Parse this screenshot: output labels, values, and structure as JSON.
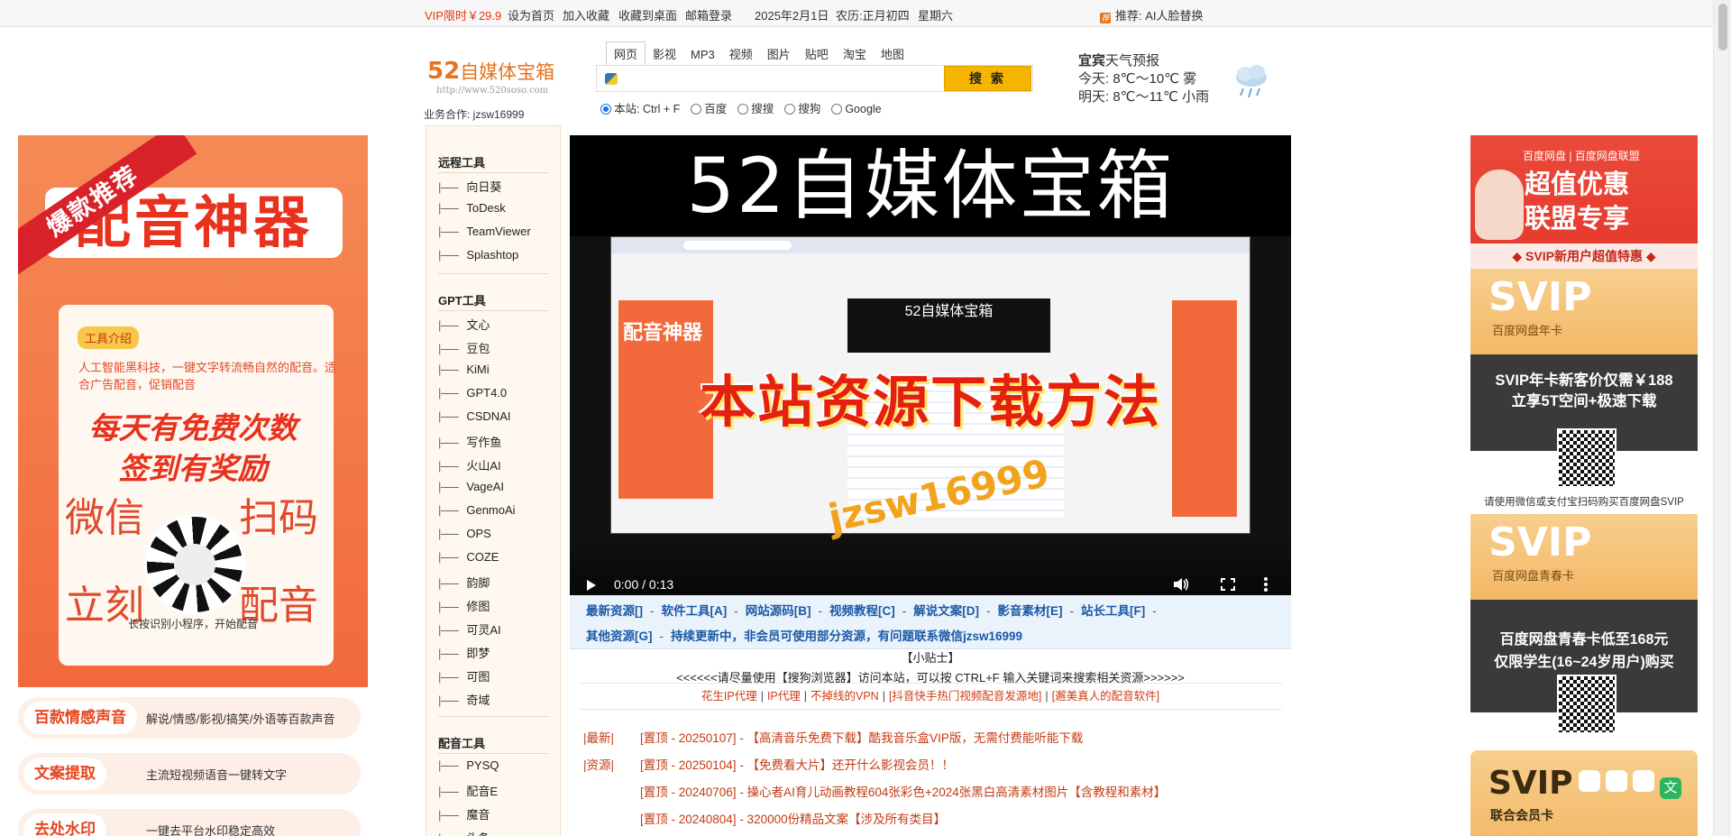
{
  "topbar": {
    "vip": "VIP限时￥29.9",
    "set_home": "设为首页",
    "add_fav": "加入收藏",
    "save_desktop": "收藏到桌面",
    "mail_login": "邮箱登录",
    "date": "2025年2月1日",
    "lunar": "农历:正月初四",
    "weekday": "星期六",
    "recommend": "推荐: AI人脸替换"
  },
  "logo": {
    "num": "52",
    "name": "自媒体宝箱",
    "url": "http://www.520soso.com"
  },
  "biz_contact": "业务合作: jzsw16999",
  "search": {
    "tabs": [
      "网页",
      "影视",
      "MP3",
      "视频",
      "图片",
      "贴吧",
      "淘宝",
      "地图"
    ],
    "active_tab": "网页",
    "placeholder": "",
    "button": "搜 索",
    "engines": [
      "本站: Ctrl + F",
      "百度",
      "搜搜",
      "搜狗",
      "Google"
    ],
    "selected_engine": "本站: Ctrl + F"
  },
  "weather": {
    "city": "宜宾",
    "title_suffix": "天气预报",
    "today": "今天: 8℃～10℃ 雾",
    "tomorrow": "明天: 8℃～11℃ 小雨",
    "icon": "rain-cloud-icon"
  },
  "left_ad": {
    "ribbon": "爆款推荐",
    "banner": "配音神器",
    "tag": "工具介绍",
    "desc": "人工智能黑科技，一键文字转流畅自然的配音。适合广告配音，促销配音",
    "line1": "每天有免费次数",
    "line2": "签到有奖励",
    "w1": "微信",
    "w2": "扫码",
    "w3": "立刻",
    "w4": "配音",
    "hint": "长按识别小程序，开始配音"
  },
  "features": [
    {
      "name": "百款情感声音",
      "desc": "解说/情感/影视/搞笑/外语等百款声音"
    },
    {
      "name": "文案提取",
      "desc": "主流短视频语音一键转文字"
    },
    {
      "name": "去处水印",
      "desc": "一键去平台水印稳定高效"
    }
  ],
  "sidenav": {
    "groups": [
      {
        "title": "远程工具",
        "items": [
          "向日葵",
          "ToDesk",
          "TeamViewer",
          "Splashtop"
        ]
      },
      {
        "title": "GPT工具",
        "items": [
          "文心",
          "豆包",
          "KiMi",
          "GPT4.0",
          "CSDNAI",
          "写作鱼",
          "火山AI",
          "VageAI",
          "GenmoAi",
          "OPS",
          "COZE",
          "韵脚",
          "修图",
          "可灵AI",
          "即梦",
          "可图",
          "奇域"
        ]
      },
      {
        "title": "配音工具",
        "items": [
          "PYSQ",
          "配音E",
          "魔音",
          "头条"
        ]
      }
    ],
    "prefix": "|------"
  },
  "video": {
    "title": "52自媒体宝箱",
    "mini_logo": "52自媒体宝箱",
    "mini_ad": "配音神器",
    "headline": "本站资源下载方法",
    "watermark": "jzsw16999",
    "time": "0:00 / 0:13",
    "buffered": 0.21
  },
  "resources": {
    "row1": [
      "最新资源[]",
      "软件工具[A]",
      "网站源码[B]",
      "视频教程[C]",
      "解说文案[D]",
      "影音素材[E]",
      "站长工具[F]"
    ],
    "row2_link": "其他资源[G]",
    "row2_text": "持续更新中，非会员可使用部分资源，有问题联系微信jzsw16999"
  },
  "tips": {
    "title": "【小贴士】",
    "text": "<<<<<<请尽量使用【搜狗浏览器】访问本站，可以按 CTRL+F 输入关键词来搜索相关资源>>>>>>"
  },
  "links": [
    "花生IP代理",
    "IP代理",
    "不掉线的VPN",
    "[抖音快手热门视频配音发源地]",
    "[邂美真人的配音软件]"
  ],
  "news": [
    {
      "tag": "|最新|",
      "text": "[置顶 - 20250107] - 【高清音乐免费下载】酷我音乐盒VIP版，无需付费能听能下载"
    },
    {
      "tag": "|资源|",
      "text": "[置顶 - 20250104] - 【免费看大片】还开什么影视会员！！"
    },
    {
      "tag": "",
      "text": "[置顶 - 20240706] - 操心者AI育儿动画教程604张彩色+2024张黑白高清素材图片【含教程和素材】"
    },
    {
      "tag": "",
      "text": "[置顶 - 20240804] - 320000份精品文案【涉及所有类目】"
    }
  ],
  "right_ad": {
    "brand": "百度网盘 | 百度网盘联盟",
    "big1": "超值优惠",
    "big2": "联盟专享",
    "sub": "◆ SVIP新用户超值特惠 ◆",
    "card1": {
      "svip": "SVIP",
      "kind": "百度网盘年卡",
      "l1": "SVIP年卡新客价仅需￥188",
      "l2": "立享5T空间+极速下载"
    },
    "note": "请使用微信或支付宝扫码购买百度网盘SVIP",
    "card2": {
      "svip": "SVIP",
      "kind": "百度网盘青春卡",
      "l1": "百度网盘青春卡低至168元",
      "l2": "仅限学生(16~24岁用户)购买"
    },
    "card3": {
      "svip": "SVIP",
      "kind": "联合会员卡",
      "l3": "文"
    }
  }
}
